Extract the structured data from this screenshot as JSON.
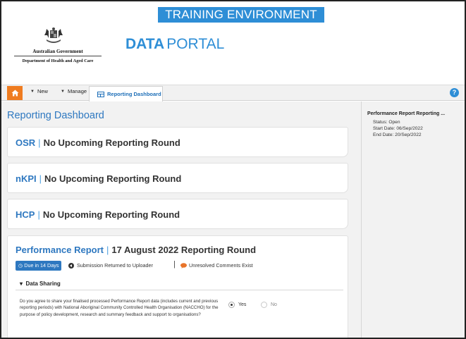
{
  "banner": {
    "text": "TRAINING ENVIRONMENT"
  },
  "header": {
    "gov_name": "Australian Government",
    "department": "Department of Health and Aged Care",
    "brand_strong": "DATA",
    "brand_light": "PORTAL"
  },
  "nav": {
    "home_icon": "home-icon",
    "new_label": "New",
    "manage_label": "Manage",
    "dashboard_label": "Reporting Dashboard",
    "help_icon": "help-icon"
  },
  "main": {
    "title": "Reporting Dashboard",
    "cards": [
      {
        "code": "OSR",
        "text": "No Upcoming Reporting Round"
      },
      {
        "code": "nKPI",
        "text": "No Upcoming Reporting Round"
      },
      {
        "code": "HCP",
        "text": "No Upcoming Reporting Round"
      }
    ],
    "performance": {
      "code": "Performance Report",
      "text": "17 August 2022 Reporting Round",
      "due_badge": "Due in 14 Days",
      "returned": "Submission Returned to Uploader",
      "comments": "Unresolved Comments Exist",
      "section": "Data Sharing",
      "question": "Do you agree to share your finalised processed Performance Report data (includes current and previous reporting periods) with National Aboriginal Community Controlled Health Organisation (NACCHO) for the purpose of policy development, research and summary feedback and support to organisations?",
      "option_yes": "Yes",
      "option_no": "No",
      "selected": "Yes"
    }
  },
  "sidebar": {
    "title": "Performance Report Reporting ...",
    "status": "Status: Open",
    "start": "Start Date: 06/Sep/2022",
    "end": "End Date: 20/Sep/2022"
  },
  "colors": {
    "accent": "#2e78c0",
    "banner": "#2e8ed6",
    "home": "#ef7c20",
    "comment": "#e8742a"
  }
}
